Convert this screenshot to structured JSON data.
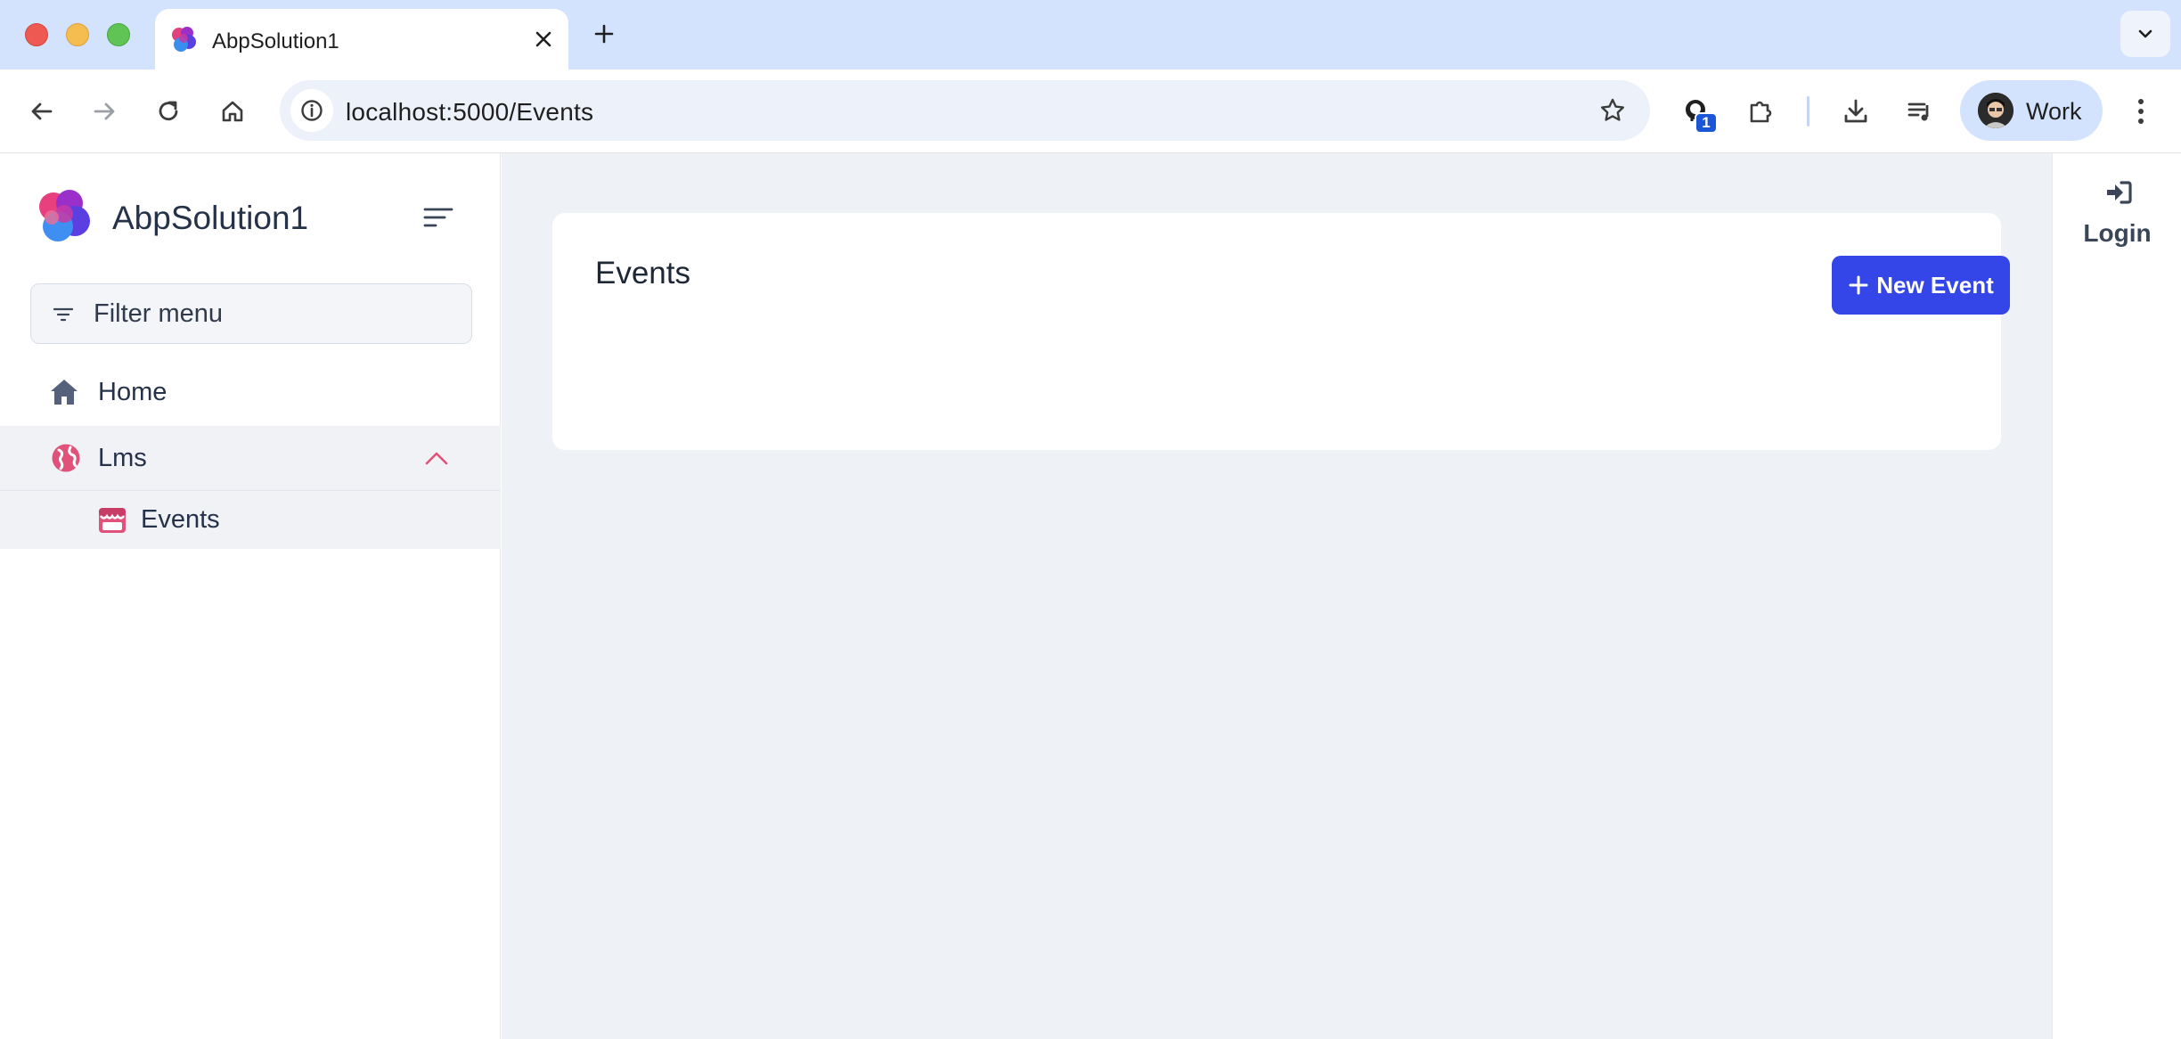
{
  "browser": {
    "tab_title": "AbpSolution1",
    "url": "localhost:5000/Events",
    "extension_badge": "1",
    "profile_label": "Work"
  },
  "sidebar": {
    "brand": "AbpSolution1",
    "filter_placeholder": "Filter menu",
    "items": [
      {
        "label": "Home",
        "icon": "home-icon"
      },
      {
        "label": "Lms",
        "icon": "globe-icon",
        "expanded": true,
        "children": [
          {
            "label": "Events",
            "icon": "store-icon",
            "active": true
          }
        ]
      }
    ]
  },
  "main": {
    "title": "Events",
    "new_button_label": "New Event"
  },
  "header": {
    "login_label": "Login"
  },
  "colors": {
    "primary": "#3446e8",
    "accent": "#e0527a",
    "chrome": "#d3e3fd",
    "content_bg": "#eef1f5"
  }
}
